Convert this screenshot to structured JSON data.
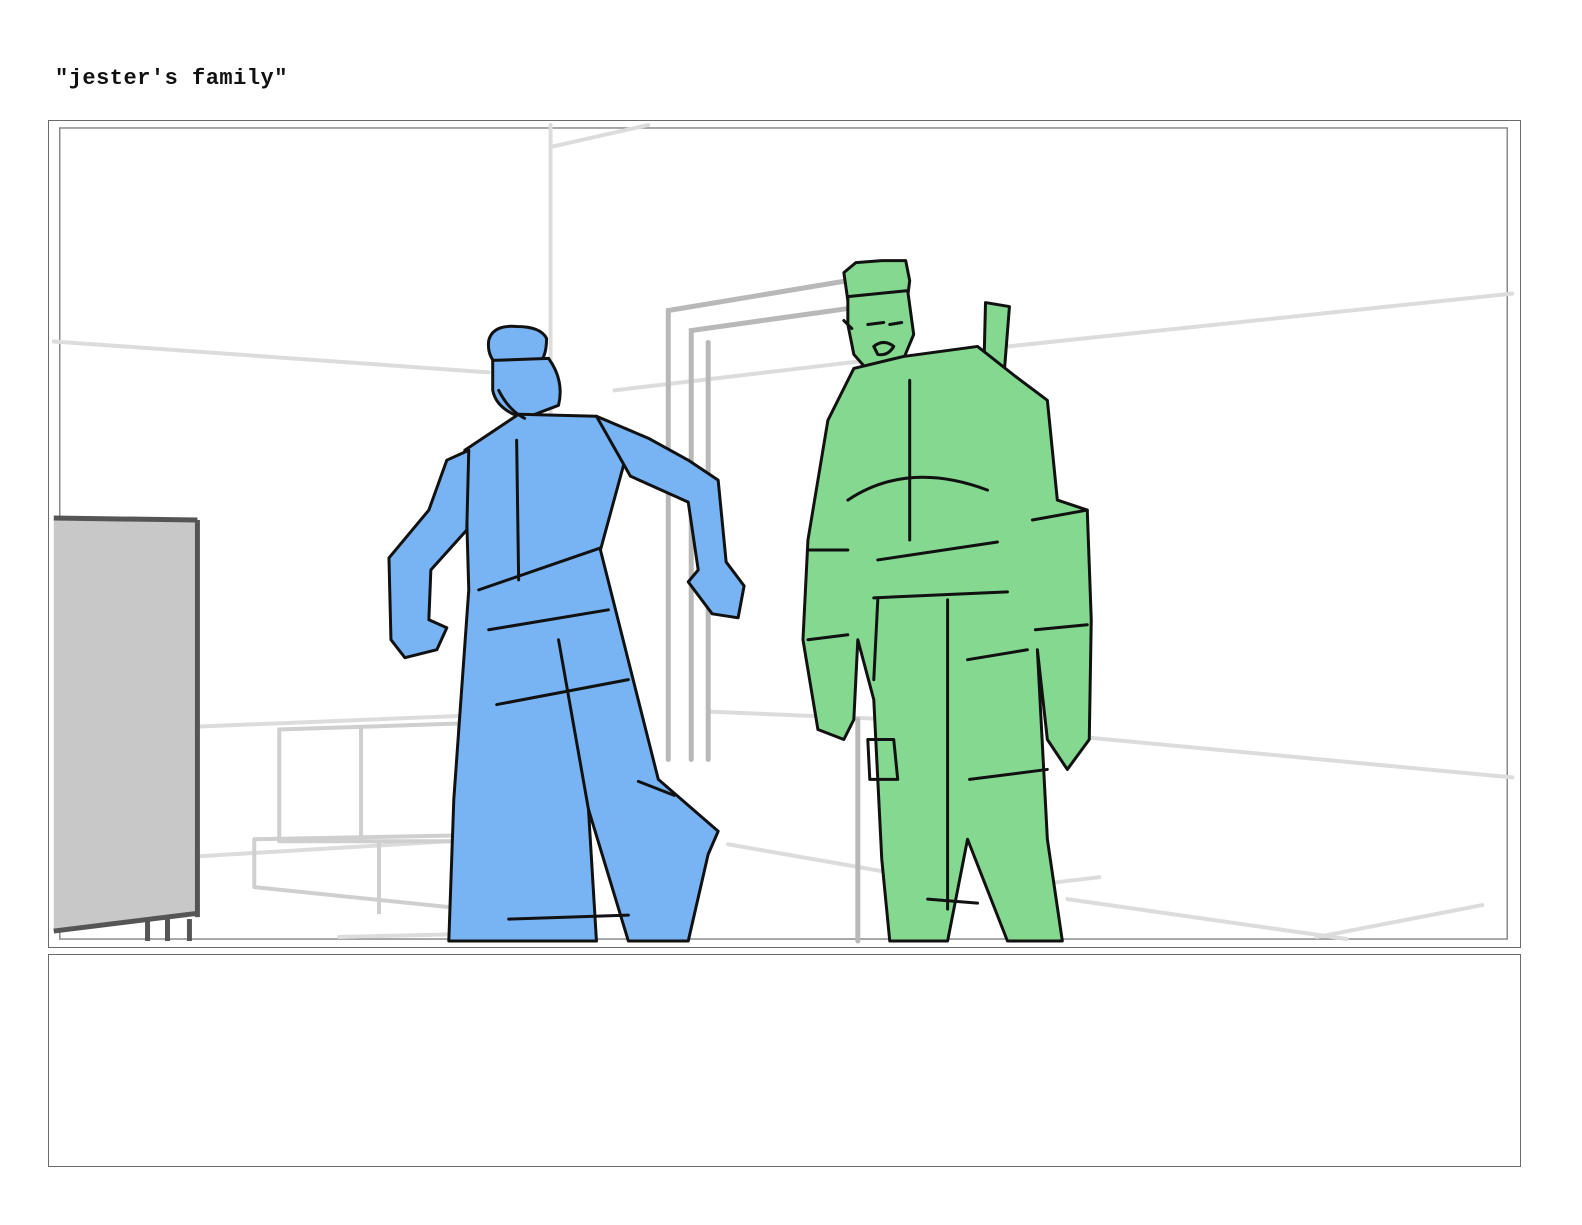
{
  "header": {
    "title": "\"jester's family\""
  },
  "panel": {
    "colors": {
      "left_figure_fill": "#78b4f4",
      "right_figure_fill": "#84d88f",
      "cabinet_fill": "#c8c8c8",
      "background_lines": "#dcdcdc",
      "ink": "#111111"
    }
  },
  "notes": {}
}
